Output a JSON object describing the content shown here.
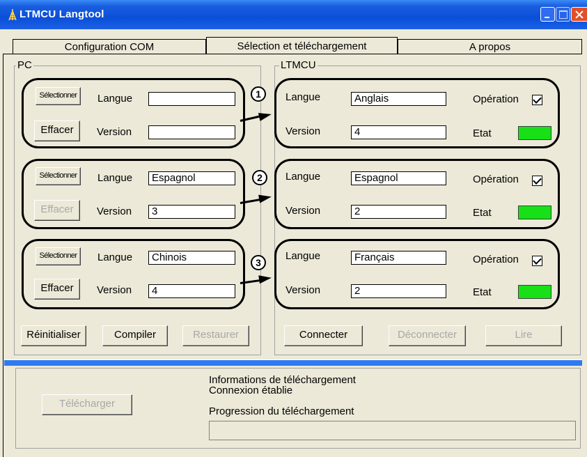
{
  "window": {
    "title": "LTMCU Langtool"
  },
  "tabs": [
    {
      "label": "Configuration  COM"
    },
    {
      "label": "Sélection et téléchargement"
    },
    {
      "label": "A propos"
    }
  ],
  "pc": {
    "group_title": "PC",
    "rows": [
      {
        "select_label": "Sélectionner",
        "clear_label": "Effacer",
        "clear_enabled": true,
        "langue_label": "Langue",
        "version_label": "Version",
        "langue": "",
        "version": ""
      },
      {
        "select_label": "Sélectionner",
        "clear_label": "Effacer",
        "clear_enabled": false,
        "langue_label": "Langue",
        "version_label": "Version",
        "langue": "Espagnol",
        "version": "3"
      },
      {
        "select_label": "Sélectionner",
        "clear_label": "Effacer",
        "clear_enabled": true,
        "langue_label": "Langue",
        "version_label": "Version",
        "langue": "Chinois",
        "version": "4"
      }
    ],
    "buttons": {
      "reset": "Réinitialiser",
      "compile": "Compiler",
      "restore": "Restaurer"
    }
  },
  "markers": [
    "1",
    "2",
    "3"
  ],
  "ltmcu": {
    "group_title": "LTMCU",
    "rows": [
      {
        "langue_label": "Langue",
        "version_label": "Version",
        "operation_label": "Opération",
        "etat_label": "Etat",
        "langue": "Anglais",
        "version": "4",
        "operation_checked": true,
        "etat_color": "#17e017"
      },
      {
        "langue_label": "Langue",
        "version_label": "Version",
        "operation_label": "Opération",
        "etat_label": "Etat",
        "langue": "Espagnol",
        "version": "2",
        "operation_checked": true,
        "etat_color": "#17e017"
      },
      {
        "langue_label": "Langue",
        "version_label": "Version",
        "operation_label": "Opération",
        "etat_label": "Etat",
        "langue": "Français",
        "version": "2",
        "operation_checked": true,
        "etat_color": "#17e017"
      }
    ],
    "buttons": {
      "connect": "Connecter",
      "disconnect": "Déconnecter",
      "read": "Lire"
    }
  },
  "download": {
    "button": "Télécharger",
    "info_title": "Informations  de  téléchargement",
    "status": "Connexion  établie",
    "progress_label": "Progression  du  téléchargement",
    "progress": 0
  },
  "icons": {
    "app": "tower-icon",
    "minimize": "minimize-icon",
    "maximize": "maximize-icon",
    "close": "close-icon"
  }
}
